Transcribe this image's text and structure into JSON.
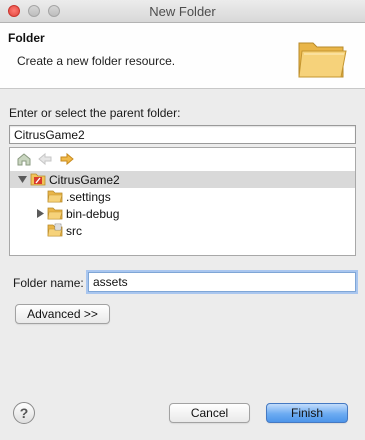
{
  "window": {
    "title": "New Folder"
  },
  "banner": {
    "title": "Folder",
    "description": "Create a new folder resource.",
    "icon": "folder-open-icon"
  },
  "parent": {
    "label": "Enter or select the parent folder:",
    "value": "CitrusGame2"
  },
  "toolbar": {
    "icons": [
      "home-icon",
      "back-arrow-icon",
      "forward-arrow-icon"
    ]
  },
  "tree": {
    "items": [
      {
        "label": "CitrusGame2",
        "icon": "project-folder-icon",
        "expanded": true,
        "selected": true
      },
      {
        "label": ".settings",
        "icon": "folder-icon"
      },
      {
        "label": "bin-debug",
        "icon": "folder-icon",
        "expandable": true
      },
      {
        "label": "src",
        "icon": "source-folder-icon"
      }
    ]
  },
  "folder_name": {
    "label": "Folder name:",
    "value": "assets"
  },
  "buttons": {
    "advanced": "Advanced >>",
    "cancel": "Cancel",
    "finish": "Finish",
    "help": "?"
  },
  "colors": {
    "accent": "#5a9cf0",
    "selection": "#d9d9d9",
    "folder": "#f2c45a"
  }
}
